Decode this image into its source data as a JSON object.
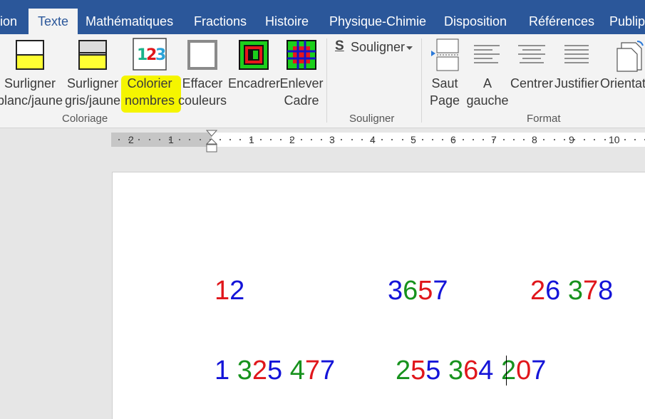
{
  "tabs": [
    {
      "label": "ion"
    },
    {
      "label": "Texte"
    },
    {
      "label": "Mathématiques"
    },
    {
      "label": "Fractions"
    },
    {
      "label": "Histoire"
    },
    {
      "label": "Physique-Chimie"
    },
    {
      "label": "Disposition"
    },
    {
      "label": "Références"
    },
    {
      "label": "Publip"
    }
  ],
  "active_tab": "Texte",
  "ribbon": {
    "coloriage": {
      "group_label": "Coloriage",
      "buttons": [
        {
          "line1": "Surligner",
          "line2": "blanc/jaune",
          "icon": "highlight-white-yellow-icon"
        },
        {
          "line1": "Surligner",
          "line2": "gris/jaune",
          "icon": "highlight-grey-yellow-icon"
        },
        {
          "line1": "Colorier",
          "line2": "nombres",
          "icon": "color-numbers-icon",
          "icon_text": "123"
        },
        {
          "line1": "Effacer",
          "line2": "couleurs",
          "icon": "erase-colors-icon"
        },
        {
          "line1": "Encadrer",
          "line2": "",
          "icon": "frame-icon"
        },
        {
          "line1": "Enlever",
          "line2": "Cadre",
          "icon": "remove-frame-icon"
        }
      ]
    },
    "souligner": {
      "group_label": "Souligner",
      "button_label": "Souligner",
      "icon": "underline-s-icon",
      "icon_text": "S",
      "dropdown_icon": "chevron-down-icon"
    },
    "format": {
      "group_label": "Format",
      "buttons": [
        {
          "line1": "Saut",
          "line2": "Page",
          "icon": "page-break-icon"
        },
        {
          "line1": "A",
          "line2": "gauche",
          "icon": "align-left-icon"
        },
        {
          "line1": "Centrer",
          "line2": "",
          "icon": "align-center-icon"
        },
        {
          "line1": "Justifier",
          "line2": "",
          "icon": "justify-icon"
        },
        {
          "line1": "Orientat",
          "line2": "",
          "icon": "orientation-icon"
        }
      ]
    }
  },
  "ruler": {
    "numbers": [
      "2",
      "1",
      "1",
      "2",
      "3",
      "4",
      "5",
      "6",
      "7",
      "8",
      "9",
      "10"
    ]
  },
  "document": {
    "lines": [
      [
        {
          "digits": [
            {
              "d": "1",
              "c": "red"
            },
            {
              "d": "2",
              "c": "blue"
            }
          ]
        },
        {
          "digits": [
            {
              "d": "3",
              "c": "blue"
            },
            {
              "d": "6",
              "c": "green"
            },
            {
              "d": "5",
              "c": "red"
            },
            {
              "d": "7",
              "c": "blue"
            }
          ]
        },
        {
          "digits": [
            {
              "d": "2",
              "c": "red"
            },
            {
              "d": "6",
              "c": "blue"
            },
            {
              "d": " ",
              "c": "blue"
            },
            {
              "d": "3",
              "c": "green"
            },
            {
              "d": "7",
              "c": "red"
            },
            {
              "d": "8",
              "c": "blue"
            }
          ]
        }
      ],
      [
        {
          "digits": [
            {
              "d": "1",
              "c": "blue"
            },
            {
              "d": " ",
              "c": "blue"
            },
            {
              "d": "3",
              "c": "green"
            },
            {
              "d": "2",
              "c": "red"
            },
            {
              "d": "5",
              "c": "blue"
            },
            {
              "d": " ",
              "c": "blue"
            },
            {
              "d": "4",
              "c": "green"
            },
            {
              "d": "7",
              "c": "red"
            },
            {
              "d": "7",
              "c": "blue"
            }
          ]
        },
        {
          "digits": [
            {
              "d": "2",
              "c": "green"
            },
            {
              "d": "5",
              "c": "red"
            },
            {
              "d": "5",
              "c": "blue"
            },
            {
              "d": " ",
              "c": "blue"
            },
            {
              "d": "3",
              "c": "green"
            },
            {
              "d": "6",
              "c": "red"
            },
            {
              "d": "4",
              "c": "blue"
            },
            {
              "d": " ",
              "c": "blue"
            },
            {
              "d": "2",
              "c": "green"
            },
            {
              "d": "0",
              "c": "red"
            },
            {
              "d": "7",
              "c": "blue"
            }
          ]
        }
      ]
    ]
  },
  "colors": {
    "ribbon_blue": "#2b579a",
    "highlight": "#f5f500",
    "red": "#e0161b",
    "blue": "#1414d8",
    "green": "#17921d"
  }
}
